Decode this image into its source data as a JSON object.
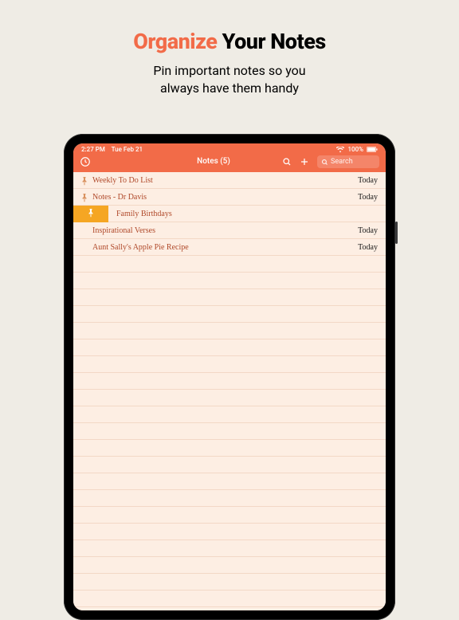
{
  "heading": {
    "accent": "Organize",
    "rest": "Your Notes",
    "subtitle_line1": "Pin important notes so you",
    "subtitle_line2": "always have them handy"
  },
  "status": {
    "time": "2:27 PM",
    "date": "Tue Feb 21",
    "battery": "100%"
  },
  "nav": {
    "title": "Notes (5)",
    "search_placeholder": "Search"
  },
  "notes": [
    {
      "title": "Weekly To Do List",
      "date": "Today",
      "pinned": true,
      "swiped": false
    },
    {
      "title": "Notes - Dr Davis",
      "date": "Today",
      "pinned": true,
      "swiped": false
    },
    {
      "title": "Family Birthdays",
      "date": "",
      "pinned": false,
      "swiped": true
    },
    {
      "title": "Inspirational Verses",
      "date": "Today",
      "pinned": false,
      "swiped": false
    },
    {
      "title": "Aunt Sally's Apple Pie Recipe",
      "date": "Today",
      "pinned": false,
      "swiped": false
    }
  ],
  "colors": {
    "accent": "#f26b48",
    "swipe_action": "#f5a623",
    "paper": "#fdeee3",
    "paper_line": "#f3d8c6",
    "ink": "#b0492a"
  }
}
